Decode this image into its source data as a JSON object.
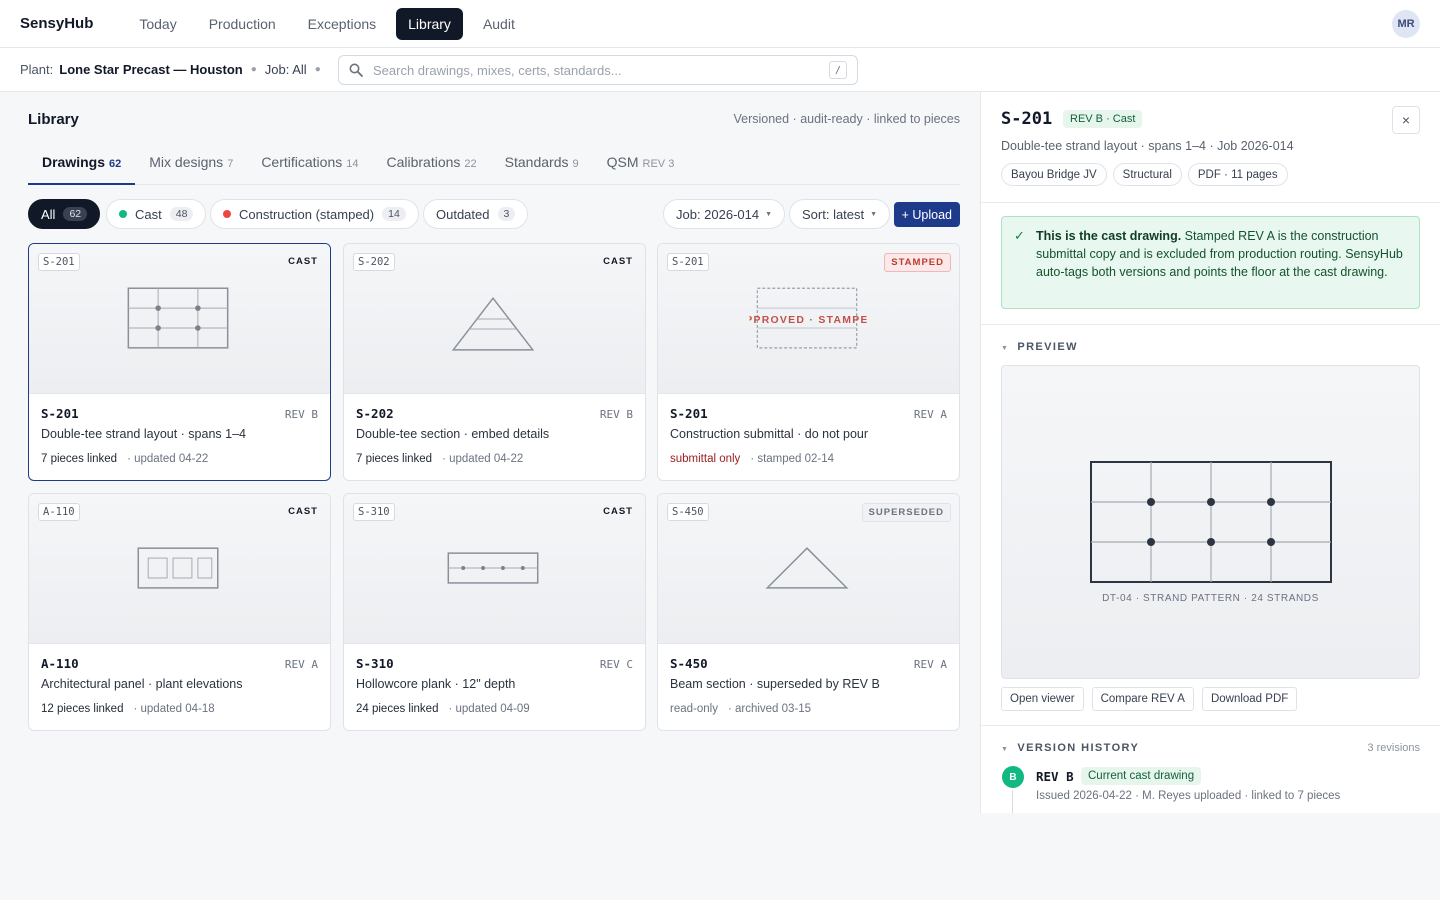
{
  "app": {
    "brand": "SensyHub",
    "user_initials": "MR"
  },
  "nav": [
    "Today",
    "Production",
    "Exceptions",
    "Library",
    "Audit"
  ],
  "context": {
    "plant_label": "Plant:",
    "plant": "Lone Star Precast — Houston",
    "job": "Job: All",
    "search_placeholder": "Search drawings, mixes, certs, standards...",
    "search_shortcut": "/"
  },
  "library": {
    "title": "Library",
    "meta": "Versioned · audit-ready · linked to pieces",
    "tabs": [
      {
        "label": "Drawings",
        "count": "62"
      },
      {
        "label": "Mix designs",
        "count": "7"
      },
      {
        "label": "Certifications",
        "count": "14"
      },
      {
        "label": "Calibrations",
        "count": "22"
      },
      {
        "label": "Standards",
        "count": "9"
      },
      {
        "label": "QSM",
        "count": "REV 3"
      }
    ],
    "filters": [
      {
        "label": "All",
        "count": "62",
        "dot": ""
      },
      {
        "label": "Cast",
        "count": "48",
        "dot": "#10b981"
      },
      {
        "label": "Construction (stamped)",
        "count": "14",
        "dot": "#ef4444"
      },
      {
        "label": "Outdated",
        "count": "3",
        "dot": ""
      }
    ],
    "job_select": "Job: 2026-014",
    "sort_select": "Sort: latest",
    "upload_label": "+ Upload",
    "cards": [
      {
        "chip": "S-201",
        "status": "CAST",
        "code": "S-201",
        "rev": "REV B",
        "desc": "Double-tee strand layout · spans 1–4",
        "foot_main": "7 pieces linked",
        "foot_meta": "· updated 04-22"
      },
      {
        "chip": "S-202",
        "status": "CAST",
        "code": "S-202",
        "rev": "REV B",
        "desc": "Double-tee section · embed details",
        "foot_main": "7 pieces linked",
        "foot_meta": "· updated 04-22"
      },
      {
        "chip": "S-201",
        "status": "STAMPED",
        "code": "S-201",
        "rev": "REV A",
        "desc": "Construction submittal · do not pour",
        "foot_main": "submittal only",
        "foot_meta": "· stamped 02-14",
        "stamp_text": "APPROVED · STAMPED"
      },
      {
        "chip": "A-110",
        "status": "CAST",
        "code": "A-110",
        "rev": "REV A",
        "desc": "Architectural panel · plant elevations",
        "foot_main": "12 pieces linked",
        "foot_meta": "· updated 04-18"
      },
      {
        "chip": "S-310",
        "status": "CAST",
        "code": "S-310",
        "rev": "REV C",
        "desc": "Hollowcore plank · 12\" depth",
        "foot_main": "24 pieces linked",
        "foot_meta": "· updated 04-09"
      },
      {
        "chip": "S-450",
        "status": "SUPERSEDED",
        "code": "S-450",
        "rev": "REV A",
        "desc": "Beam section · superseded by REV B",
        "foot_main": "read-only",
        "foot_meta": "· archived 03-15"
      }
    ]
  },
  "panel": {
    "title": "S-201",
    "badge": "REV B · Cast",
    "close": "×",
    "subtitle": "Double-tee strand layout · spans 1–4 · Job 2026-014",
    "tags": [
      "Bayou Bridge JV",
      "Structural",
      "PDF · 11 pages"
    ],
    "callout_bold": "This is the cast drawing.",
    "callout_text": " Stamped REV A is the construction submittal copy and is excluded from production routing. SensyHub auto-tags both versions and points the floor at the cast drawing.",
    "preview_heading": "PREVIEW",
    "preview_caption": "DT-04 · STRAND PATTERN · 24 STRANDS",
    "buttons": [
      "Open viewer",
      "Compare REV A",
      "Download PDF"
    ],
    "history_heading": "VERSION HISTORY",
    "history_count": "3 revisions",
    "revision": {
      "dot": "B",
      "name": "REV B",
      "badge": "Current cast drawing",
      "meta": "Issued 2026-04-22 · M. Reyes uploaded · linked to 7 pieces"
    }
  },
  "colors": {
    "accent": "#1e3a8a",
    "cast": "#10b981",
    "stamped": "#ef4444"
  }
}
